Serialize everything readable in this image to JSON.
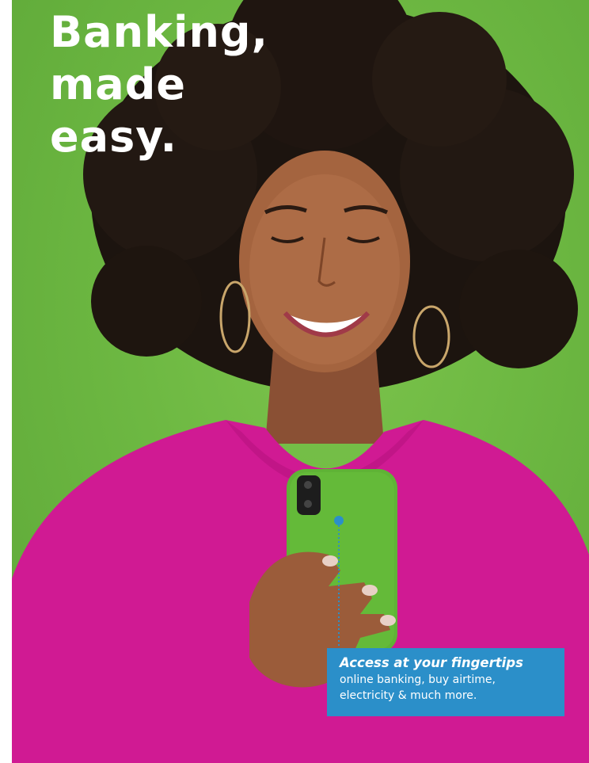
{
  "headline": {
    "line1": "Banking,",
    "line2": "made",
    "line3": "easy."
  },
  "callout": {
    "title": "Access at your fingertips",
    "body": "online banking, buy airtime, electricity & much more."
  },
  "colors": {
    "background_green": "#6db842",
    "shirt_magenta": "#d01a93",
    "phone_green": "#5fb336",
    "callout_blue": "#2b8fc9",
    "text_white": "#ffffff"
  },
  "icons": [
    "hair",
    "face",
    "phone",
    "callout-dot"
  ]
}
